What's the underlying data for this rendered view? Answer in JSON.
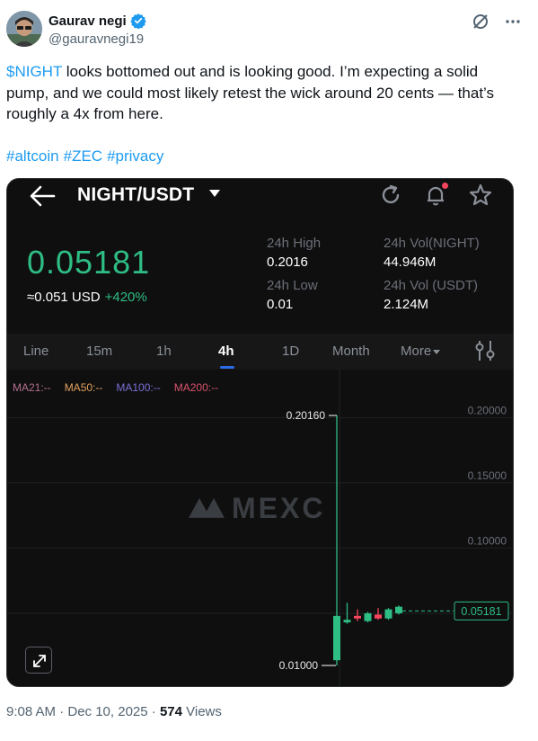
{
  "author": {
    "display_name": "Gaurav negi",
    "handle": "@gauravnegi19"
  },
  "tweet": {
    "cashtag": "$NIGHT",
    "text": " looks bottomed out and is looking good. I’m expecting a solid pump, and we could most likely retest the wick around 20 cents — that’s roughly a 4x from here.",
    "hashtags": [
      "#altcoin",
      "#ZEC",
      "#privacy"
    ]
  },
  "card": {
    "pair": "NIGHT/USDT",
    "price": "0.05181",
    "approx_usd": "≈0.051 USD",
    "change": "+420%",
    "stats": {
      "high_label": "24h High",
      "high_value": "0.2016",
      "low_label": "24h Low",
      "low_value": "0.01",
      "vol_base_label": "24h Vol(NIGHT)",
      "vol_base_value": "44.946M",
      "vol_quote_label": "24h Vol (USDT)",
      "vol_quote_value": "2.124M"
    },
    "tabs": [
      "Line",
      "15m",
      "1h",
      "4h",
      "1D",
      "Month",
      "More"
    ],
    "active_tab": "4h",
    "ma_legend": [
      {
        "label": "MA21:--",
        "color": "#b4708e"
      },
      {
        "label": "MA50:--",
        "color": "#e0a060"
      },
      {
        "label": "MA100:--",
        "color": "#7b6fd6"
      },
      {
        "label": "MA200:--",
        "color": "#d9536b"
      }
    ],
    "watermark": "MEXC",
    "accent_up": "#2ebd85",
    "accent_down": "#f6465d"
  },
  "chart_data": {
    "type": "candlestick",
    "y_ticks": [
      "0.20000",
      "0.15000",
      "0.10000"
    ],
    "ylim": [
      0.0,
      0.22
    ],
    "high_marker": "0.20160",
    "low_marker": "0.01000",
    "last_price_tag": "0.05181",
    "candles": [
      {
        "open": 0.014,
        "close": 0.048,
        "high": 0.2016,
        "low": 0.01
      },
      {
        "open": 0.043,
        "close": 0.045,
        "high": 0.058,
        "low": 0.042
      },
      {
        "open": 0.048,
        "close": 0.046,
        "high": 0.053,
        "low": 0.044
      },
      {
        "open": 0.044,
        "close": 0.05,
        "high": 0.051,
        "low": 0.043
      },
      {
        "open": 0.049,
        "close": 0.046,
        "high": 0.054,
        "low": 0.045
      },
      {
        "open": 0.046,
        "close": 0.053,
        "high": 0.054,
        "low": 0.045
      },
      {
        "open": 0.05,
        "close": 0.055,
        "high": 0.056,
        "low": 0.049
      }
    ]
  },
  "footer": {
    "time": "9:08 AM · Dec 10, 2025 · ",
    "views_count": "574",
    "views_label": " Views"
  }
}
